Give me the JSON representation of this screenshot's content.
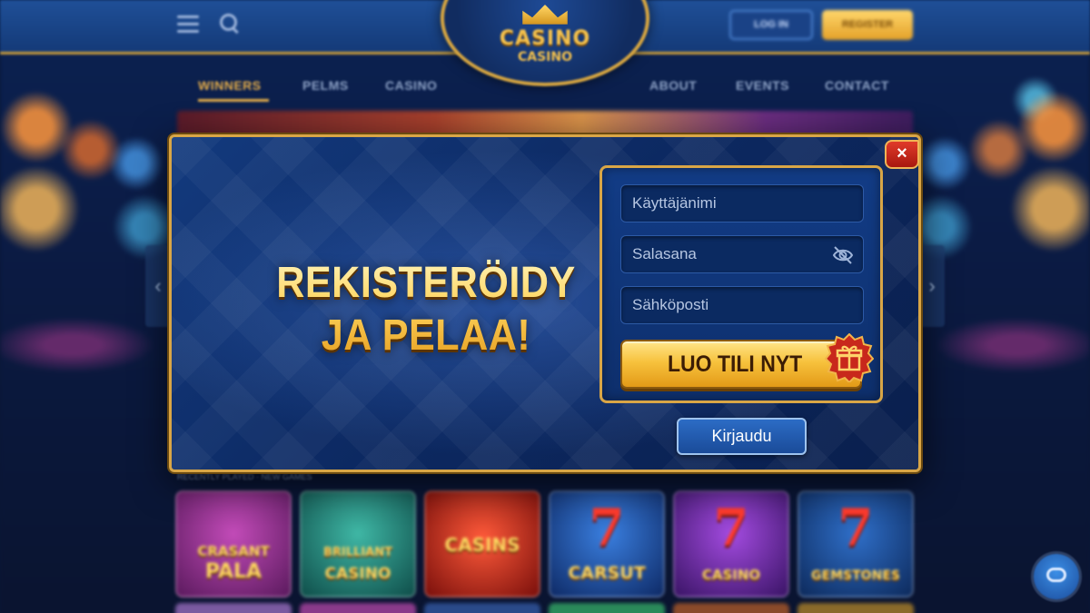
{
  "background_site": {
    "logo_text": "CASINO",
    "logo_sub": "CASINO",
    "header_login_label": "LOG IN",
    "header_register_label": "REGISTER",
    "nav": [
      "WINNERS",
      "PELMS",
      "CASINO",
      "ABOUT",
      "EVENTS",
      "CONTACT"
    ],
    "section_label": "RECENTLY PLAYED · NEW GAMES",
    "tiles": [
      {
        "line1": "CRASANT",
        "line2": "PALA",
        "color": "#8a2a86"
      },
      {
        "line1": "BRILLIANT",
        "line2": "CASINO",
        "color": "#2a8a7a"
      },
      {
        "line1": "CASINS",
        "line2": "",
        "color": "#b8281e"
      },
      {
        "line1": "7",
        "line2": "CARSUT",
        "color": "#1d4d9a"
      },
      {
        "line1": "7",
        "line2": "CASINO",
        "color": "#6a2a9a"
      },
      {
        "line1": "7",
        "line2": "GEMSTONES",
        "color": "#1f4a8a"
      }
    ]
  },
  "modal": {
    "close_label": "×",
    "headline_line1": "REKISTERÖIDY",
    "headline_line2": "JA PELAA!",
    "form": {
      "username_placeholder": "Käyttäjänimi",
      "password_placeholder": "Salasana",
      "email_placeholder": "Sähköposti",
      "submit_label": "LUO TILI NYT"
    },
    "login_label": "Kirjaudu"
  },
  "colors": {
    "gold": "#d9a646",
    "modal_bg": "#0c2860",
    "cta_gold": "#f7c23d",
    "close_red": "#c8241a"
  },
  "icons": [
    "menu-icon",
    "search-icon",
    "close-icon",
    "eye-off-icon",
    "gift-icon",
    "chat-icon"
  ]
}
